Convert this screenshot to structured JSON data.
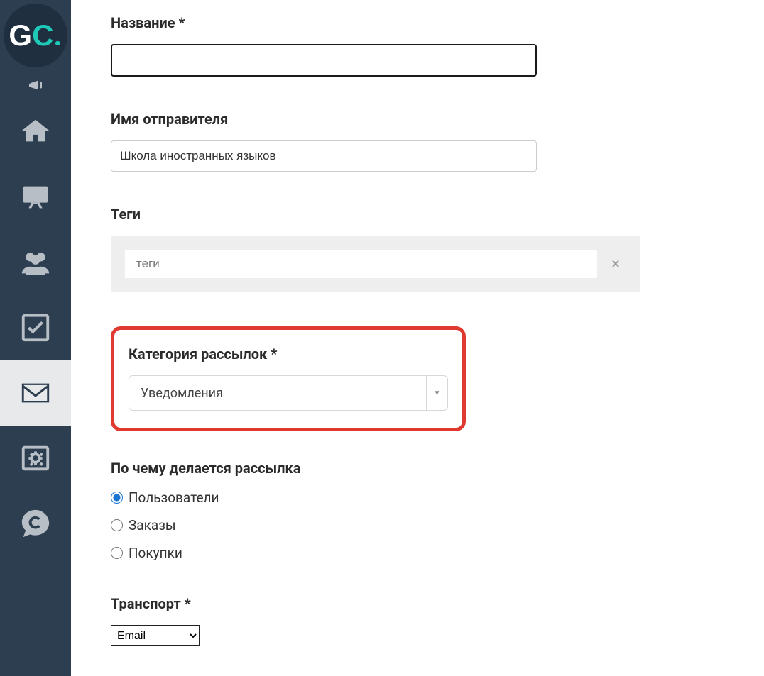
{
  "logo": {
    "g": "G",
    "c": "C",
    "dot": "."
  },
  "sidebar": {
    "items": [
      {
        "name": "announce-icon"
      },
      {
        "name": "home-icon"
      },
      {
        "name": "presentation-icon"
      },
      {
        "name": "users-icon"
      },
      {
        "name": "tasks-icon"
      },
      {
        "name": "mail-icon",
        "active": true
      },
      {
        "name": "safe-icon"
      },
      {
        "name": "chat-icon"
      }
    ]
  },
  "form": {
    "title": {
      "label": "Название *",
      "value": ""
    },
    "sender": {
      "label": "Имя отправителя",
      "value": "Школа иностранных языков"
    },
    "tags": {
      "label": "Теги",
      "placeholder": "теги",
      "clear_glyph": "×"
    },
    "category": {
      "label": "Категория рассылок *",
      "value": "Уведомления",
      "caret": "▼"
    },
    "basis": {
      "label": "По чему делается рассылка",
      "options": [
        {
          "label": "Пользователи",
          "checked": true
        },
        {
          "label": "Заказы",
          "checked": false
        },
        {
          "label": "Покупки",
          "checked": false
        }
      ]
    },
    "transport": {
      "label": "Транспорт *",
      "value": "Email"
    }
  }
}
